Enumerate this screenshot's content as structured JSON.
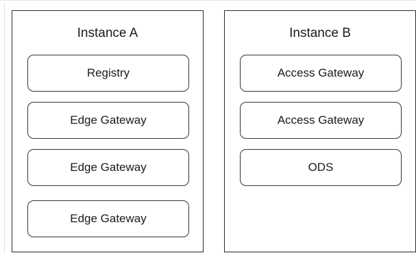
{
  "instances": [
    {
      "title": "Instance A",
      "nodes": [
        "Registry",
        "Edge Gateway",
        "Edge Gateway",
        "Edge Gateway"
      ]
    },
    {
      "title": "Instance B",
      "nodes": [
        "Access Gateway",
        "Access Gateway",
        "ODS"
      ]
    }
  ],
  "colors": {
    "border": "#2b2b2b",
    "text": "#1a1a1a",
    "background": "#ffffff"
  }
}
